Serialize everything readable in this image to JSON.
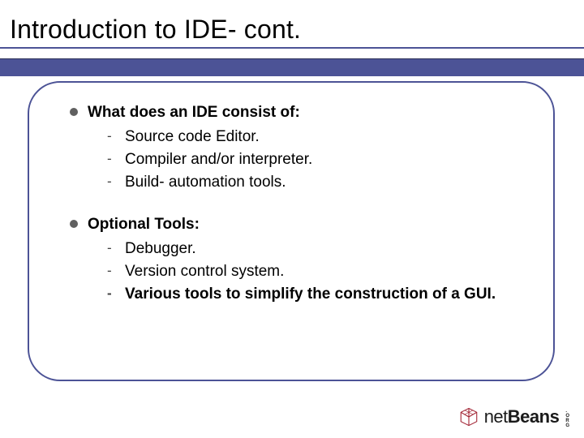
{
  "title": "Introduction to IDE- cont.",
  "groups": [
    {
      "heading": "What does an IDE consist of:",
      "items": [
        {
          "text": "Source code Editor.",
          "bold": false
        },
        {
          "text": "Compiler and/or interpreter.",
          "bold": false
        },
        {
          "text": "Build- automation tools.",
          "bold": false
        }
      ]
    },
    {
      "heading": "Optional Tools:",
      "items": [
        {
          "text": "Debugger.",
          "bold": false
        },
        {
          "text": "Version control system.",
          "bold": false
        },
        {
          "text": "Various tools to simplify the construction of a GUI.",
          "bold": true
        }
      ]
    }
  ],
  "logo": {
    "brand_part1": "net",
    "brand_part2": "Beans",
    "org": ".ORG"
  }
}
